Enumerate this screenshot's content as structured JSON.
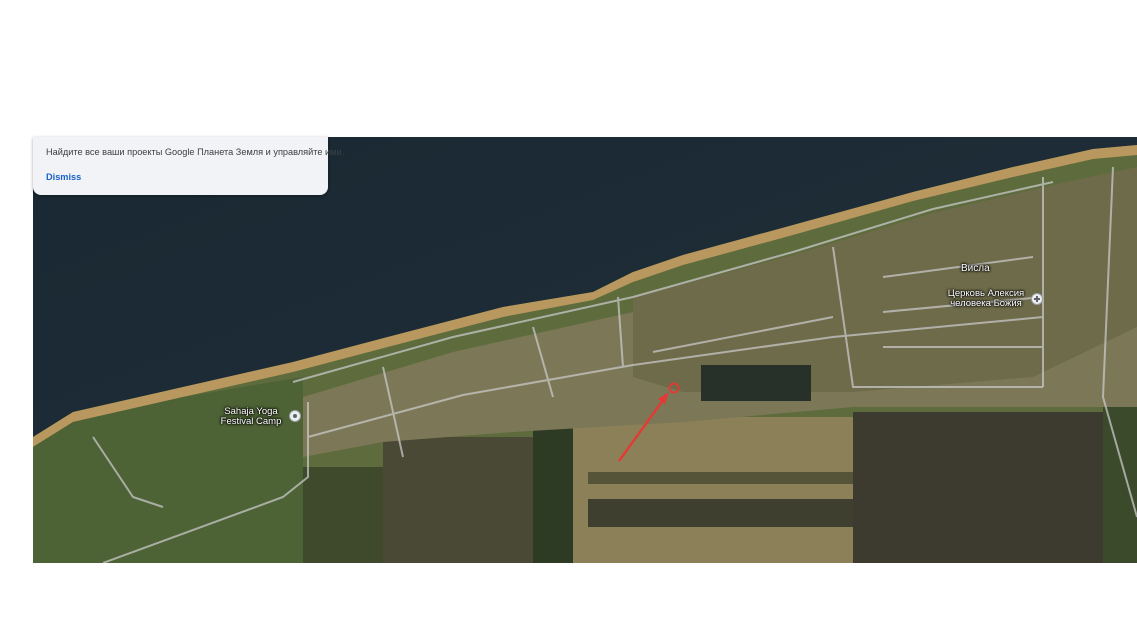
{
  "banner": {
    "text": "Найдите все ваши проекты Google Планета Земля и управляйте ими.",
    "dismiss_label": "Dismiss"
  },
  "map": {
    "view": "satellite",
    "places": [
      {
        "id": "sahaja",
        "name_line1": "Sahaja Yoga",
        "name_line2": "Festival Camp",
        "icon": "place-pin-icon"
      },
      {
        "id": "visla",
        "name": "Висла"
      },
      {
        "id": "church",
        "name_line1": "Церковь Алексия",
        "name_line2": "человека Божия",
        "icon": "church-pin-icon"
      }
    ],
    "annotation": {
      "type": "red-arrow-with-circle",
      "color": "#e53935"
    }
  },
  "colors": {
    "water": "#1c2a35",
    "beach": "#b8985e",
    "fields": "#7c7857",
    "banner_bg": "#f1f3f6",
    "link": "#1a62c8"
  }
}
